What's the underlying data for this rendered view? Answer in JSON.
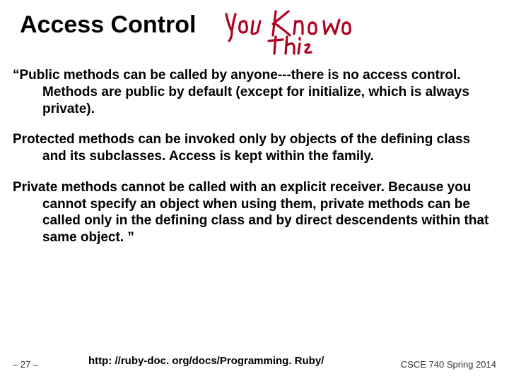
{
  "title": "Access Control",
  "annotation_label": "You Know this",
  "paragraphs": {
    "p1": "“Public methods can be called by anyone---there is no access control. Methods are public by default (except for initialize, which is always private).",
    "p2": "Protected methods can be invoked only by objects of the defining class and its subclasses. Access is kept within the family.",
    "p3": "Private methods cannot be called with an explicit receiver. Because you cannot specify an object when using them, private methods can be called only in the defining class and by direct descendents within that same object. ”"
  },
  "footer": {
    "page": "– 27 –",
    "link": "http: //ruby-doc. org/docs/Programming. Ruby/",
    "course": "CSCE 740 Spring 2014"
  }
}
